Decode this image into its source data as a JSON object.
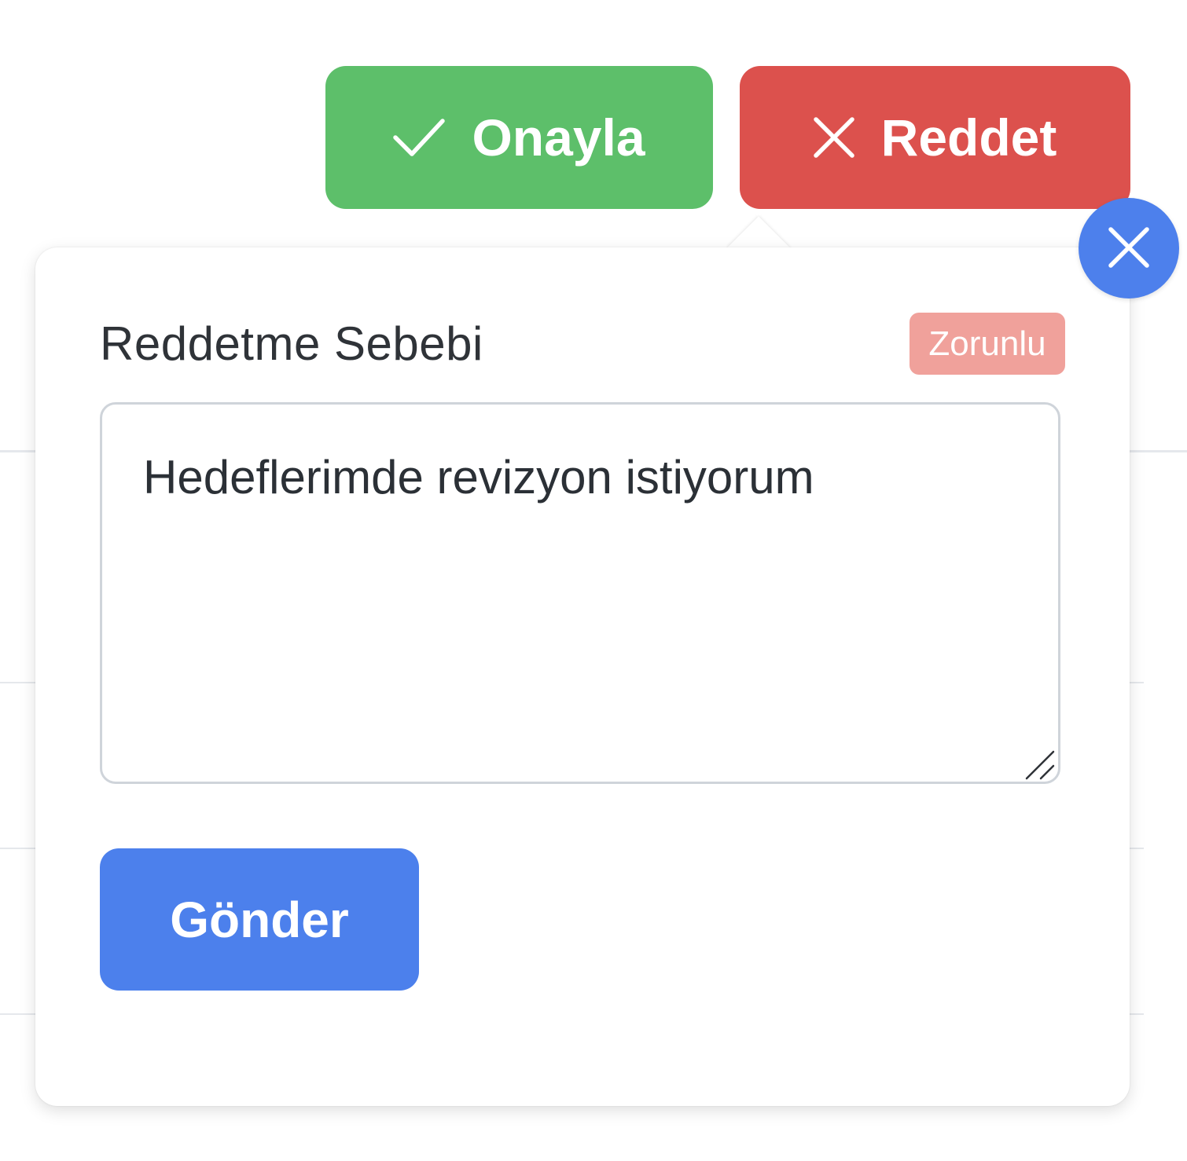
{
  "actions": {
    "approve_label": "Onayla",
    "reject_label": "Reddet"
  },
  "popover": {
    "field_label": "Reddetme Sebebi",
    "required_badge": "Zorunlu",
    "reason_value": "Hedeflerimde revizyon istiyorum",
    "submit_label": "Gönder"
  },
  "icons": {
    "approve": "check-icon",
    "reject": "x-icon",
    "close": "close-icon",
    "resize": "resize-grip-icon"
  },
  "colors": {
    "approve": "#5dbf6a",
    "reject": "#dc514d",
    "primary": "#4c80ec",
    "badge": "#f0a19b"
  }
}
